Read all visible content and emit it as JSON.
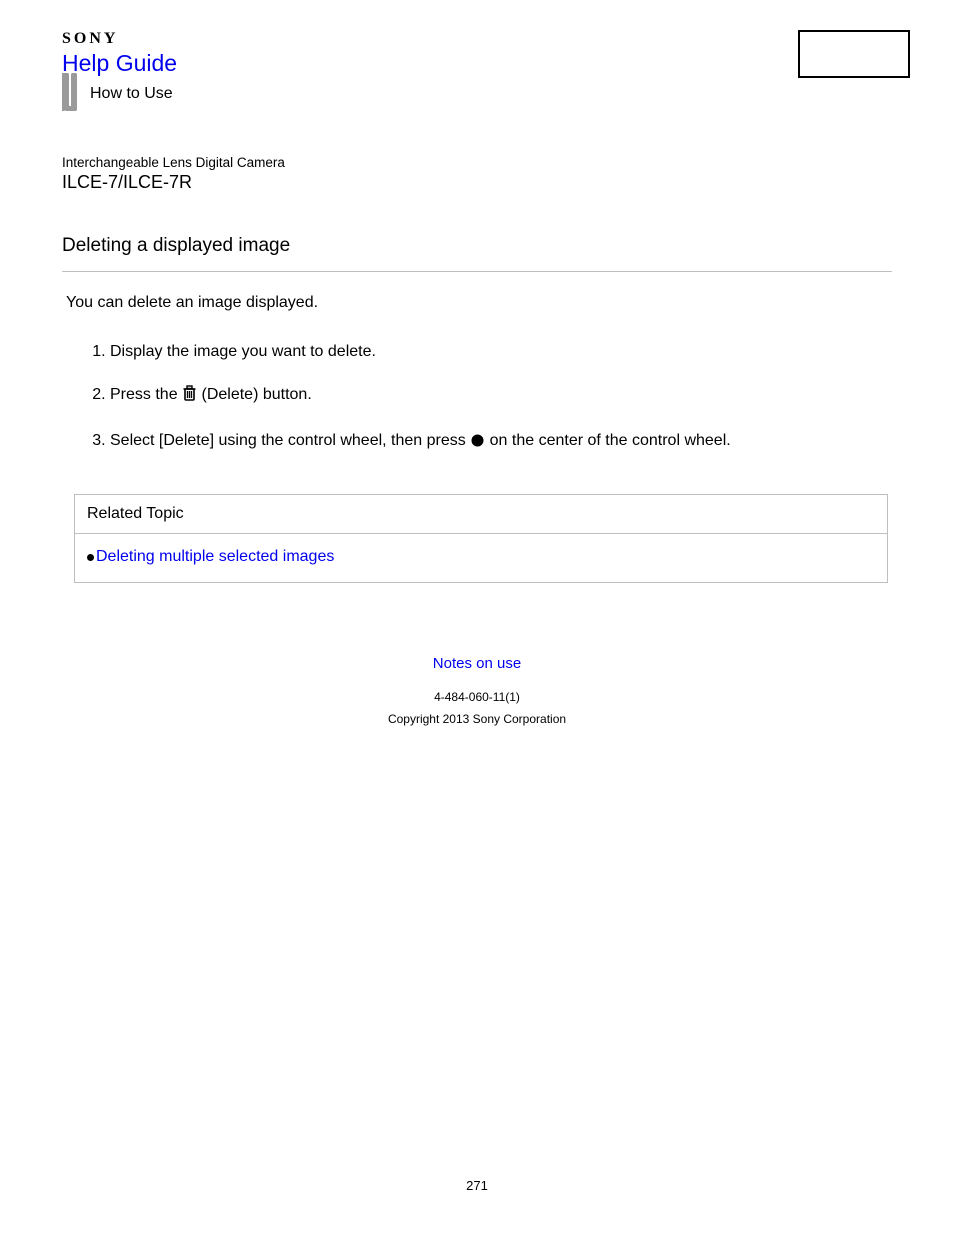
{
  "header": {
    "brand": "SONY",
    "help_guide": "Help Guide",
    "how_to_use": "How to Use"
  },
  "product": {
    "type": "Interchangeable Lens Digital Camera",
    "model": "ILCE-7/ILCE-7R"
  },
  "content": {
    "title": "Deleting a displayed image",
    "intro": "You can delete an image displayed.",
    "steps": [
      {
        "text": "Display the image you want to delete."
      },
      {
        "prefix": "Press the ",
        "icon": "trash",
        "suffix": "(Delete) button."
      },
      {
        "prefix": "Select [Delete] using the control wheel, then press ",
        "icon": "dot",
        "suffix": "on the center of the control wheel."
      }
    ]
  },
  "related": {
    "heading": "Related Topic",
    "links": [
      "Deleting multiple selected images"
    ]
  },
  "footer": {
    "notes_link": "Notes on use",
    "doc_number": "4-484-060-11(1)",
    "copyright": "Copyright 2013 Sony Corporation",
    "page_number": "271"
  }
}
